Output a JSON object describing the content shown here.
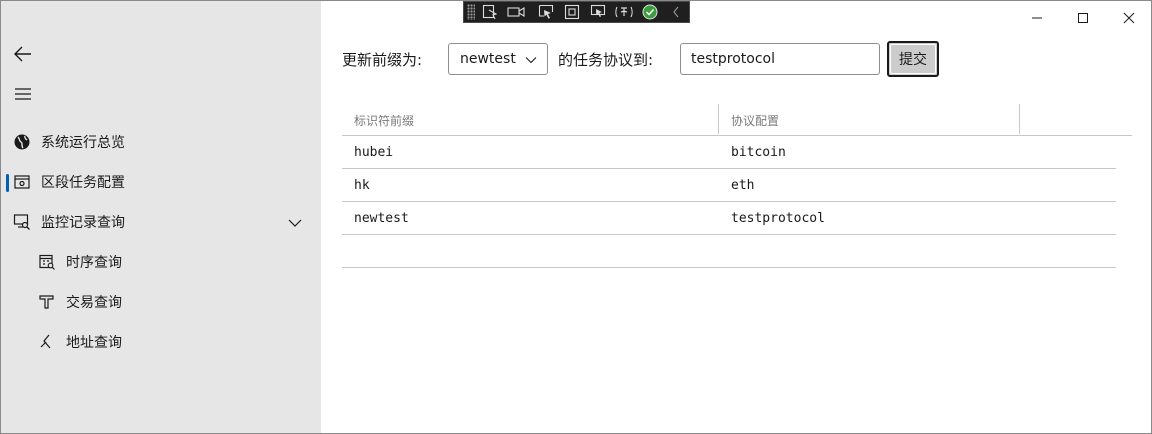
{
  "sidebar": {
    "items": [
      {
        "label": "系统运行总览",
        "icon": "globe-icon"
      },
      {
        "label": "区段任务配置",
        "icon": "config-panel-icon",
        "selected": true
      },
      {
        "label": "监控记录查询",
        "icon": "monitor-search-icon",
        "expandable": true
      },
      {
        "label": "时序查询",
        "icon": "calendar-search-icon"
      },
      {
        "label": "交易查询",
        "icon": "transaction-icon"
      },
      {
        "label": "地址查询",
        "icon": "address-icon"
      }
    ],
    "accent_color": "#005fb8"
  },
  "form": {
    "prefix_label": "更新前缀为:",
    "prefix_selected": "newtest",
    "protocol_label": "的任务协议到:",
    "protocol_value": "testprotocol",
    "submit_label": "提交"
  },
  "grid": {
    "columns": [
      "标识符前缀",
      "协议配置"
    ],
    "rows": [
      [
        "hubei",
        "bitcoin"
      ],
      [
        "hk",
        "eth"
      ],
      [
        "newtest",
        "testprotocol"
      ]
    ]
  }
}
